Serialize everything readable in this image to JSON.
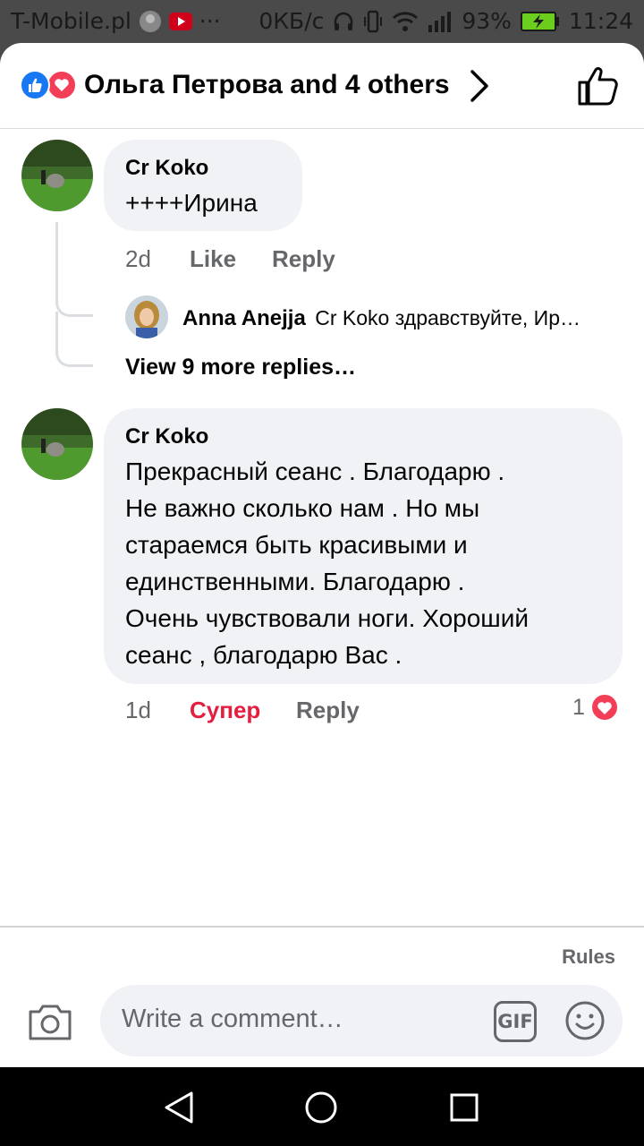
{
  "status_bar": {
    "carrier": "T-Mobile.pl",
    "dots": "···",
    "speed": "0КБ/с",
    "battery": "93%",
    "time": "11:24"
  },
  "header": {
    "title": "Ольга Петрова and 4 others"
  },
  "comments": [
    {
      "author": "Cr Koko",
      "text": "++++Ирина",
      "time": "2d",
      "like_label": "Like",
      "reply_label": "Reply",
      "reply_preview": {
        "author": "Anna Anejja",
        "text": "Cr Koko здравствуйте, Ир…"
      },
      "more_replies": "View 9 more replies…"
    },
    {
      "author": "Cr Koko",
      "text_lines": [
        "Прекрасный сеанс . Благодарю .",
        "Не важно сколько нам . Но мы",
        "стараемся быть красивыми и",
        "единственными.  Благодарю .",
        "Очень чувствовали ноги.  Хороший",
        "сеанс , благодарю Вас ."
      ],
      "time": "1d",
      "reaction_label": "Супер",
      "reply_label": "Reply",
      "reaction_count": "1"
    }
  ],
  "composer": {
    "rules": "Rules",
    "placeholder": "Write a comment…",
    "gif": "GIF"
  },
  "colors": {
    "accent_red": "#e41e3f",
    "like_blue": "#1877f2",
    "love_red": "#f33e58",
    "bubble": "#f0f2f5",
    "meta_gray": "#65676b"
  },
  "icons": [
    "like-reaction-icon",
    "love-reaction-icon",
    "chevron-right-icon",
    "thumbs-up-icon",
    "camera-icon",
    "gif-icon",
    "emoji-icon",
    "heart-reaction-icon",
    "back-nav-icon",
    "home-nav-icon",
    "recents-nav-icon"
  ]
}
